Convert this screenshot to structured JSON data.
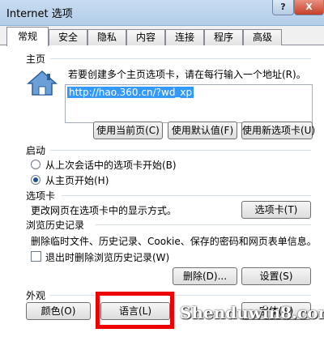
{
  "window": {
    "title": "Internet 选项",
    "help_label": "?",
    "close_label": "X",
    "help_icon": "help-icon",
    "close_icon": "close-icon"
  },
  "tabs": [
    {
      "label": "常规",
      "active": true
    },
    {
      "label": "安全"
    },
    {
      "label": "隐私"
    },
    {
      "label": "内容"
    },
    {
      "label": "连接"
    },
    {
      "label": "程序"
    },
    {
      "label": "高级"
    }
  ],
  "homepage": {
    "heading": "主页",
    "instruction": "若要创建多个主页选项卡，请在每行输入一个地址(R)。",
    "icon": "house-icon",
    "url_value": "http://hao.360.cn/?wd_xp",
    "use_current_label": "使用当前页(C)",
    "use_default_label": "使用默认值(F)",
    "use_new_tab_label": "使用新选项卡(U)"
  },
  "startup": {
    "heading": "启动",
    "option_last_session": "从上次会话中的选项卡开始(B)",
    "option_homepage": "从主页开始(H)",
    "selected": "option_homepage"
  },
  "tabs_section": {
    "heading": "选项卡",
    "description": "更改网页在选项卡中的显示方式。",
    "button_label": "选项卡(T)"
  },
  "history": {
    "heading": "浏览历史记录",
    "description": "删除临时文件、历史记录、Cookie、保存的密码和网页表单信息。",
    "delete_on_exit_label": "退出时删除浏览历史记录(W)",
    "delete_on_exit_checked": false,
    "delete_label": "删除(D)...",
    "settings_label": "设置(S)"
  },
  "appearance": {
    "heading": "外观",
    "colors_label": "颜色(O)",
    "languages_label": "语言(L)",
    "fonts_label": "字体(N)"
  },
  "watermark": "Shenduwin8.com",
  "colors": {
    "selection": "#3399ff",
    "highlight_box": "#ee0000"
  }
}
